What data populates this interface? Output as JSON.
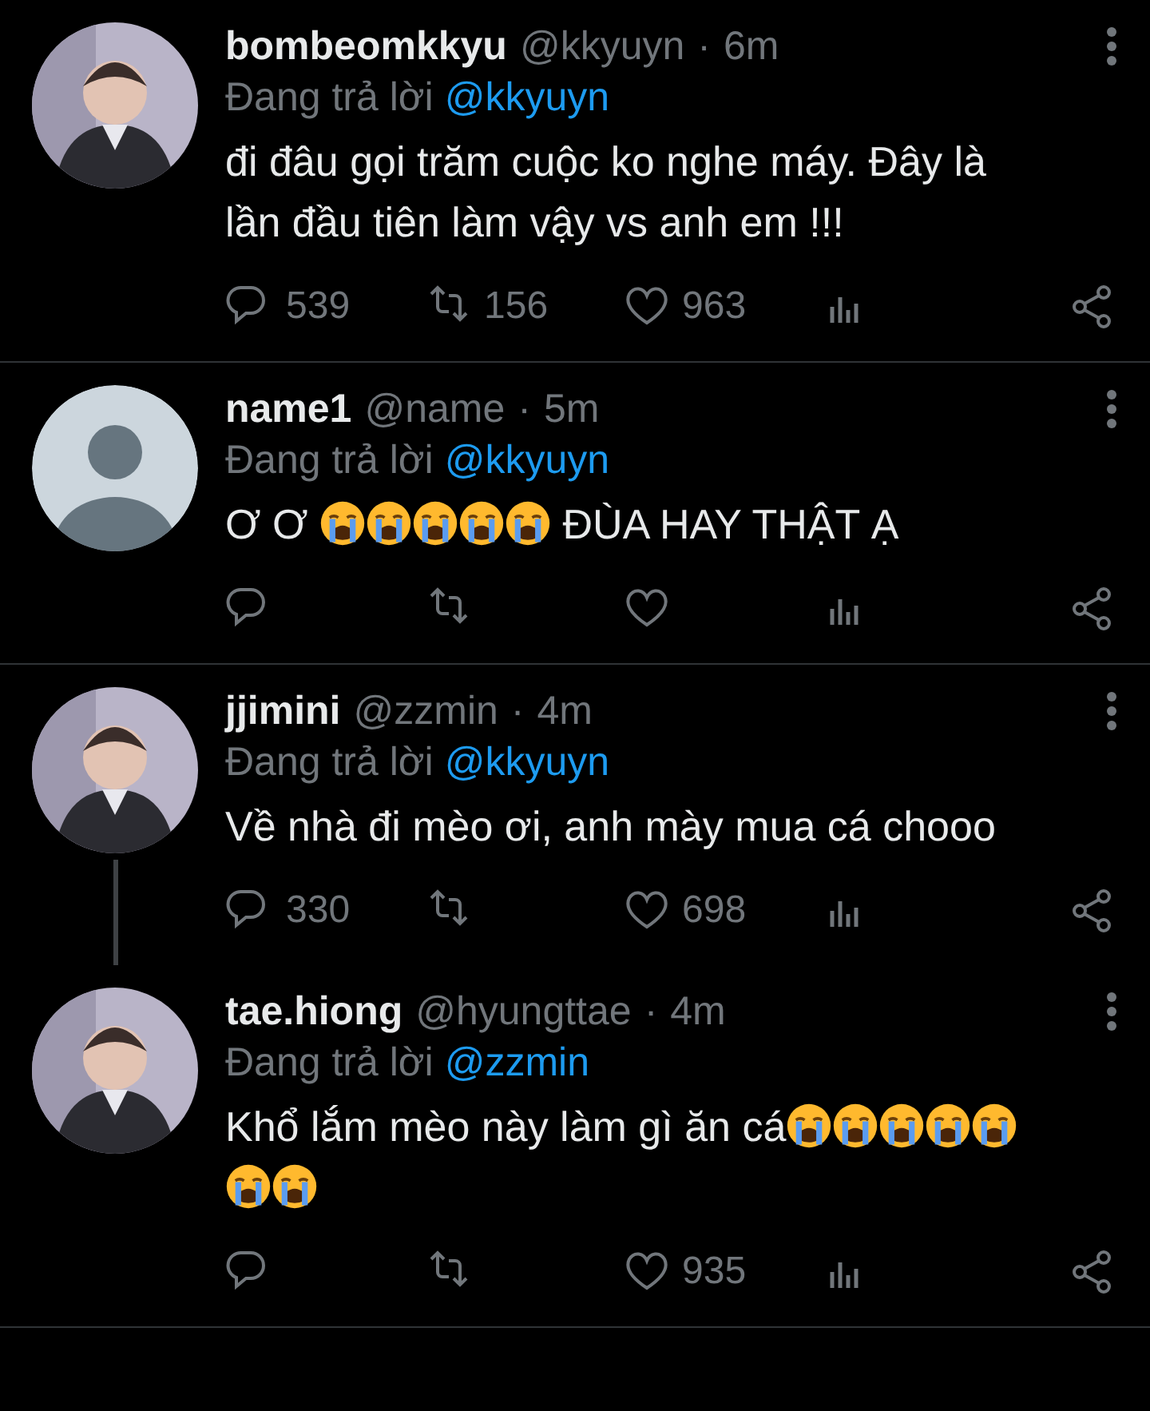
{
  "tweets": [
    {
      "name": "bombeomkkyu",
      "handle": "@kkyuyn",
      "separator": "·",
      "time": "6m",
      "reply_prefix": "Đang trả lời",
      "reply_to": "@kkyuyn",
      "body": [
        {
          "kind": "text",
          "text": "đi đâu gọi trăm cuộc ko nghe máy. Đây là lần đầu tiên làm vậy vs anh em !!!"
        }
      ],
      "replies": "539",
      "retweets": "156",
      "likes": "963",
      "connected_below": false
    },
    {
      "avatar": {
        "kind": "default"
      },
      "name": "name1",
      "handle": "@name",
      "separator": "·",
      "time": "5m",
      "reply_prefix": "Đang trả lời",
      "reply_to": "@kkyuyn",
      "body": [
        {
          "kind": "text",
          "text": "Ơ Ơ "
        },
        {
          "kind": "emoji"
        },
        {
          "kind": "emoji"
        },
        {
          "kind": "emoji"
        },
        {
          "kind": "emoji"
        },
        {
          "kind": "emoji"
        },
        {
          "kind": "text",
          "text": " ĐÙA HAY THẬT Ạ"
        }
      ],
      "connected_below": false
    },
    {
      "name": "jjimini",
      "handle": "@zzmin",
      "separator": "·",
      "time": "4m",
      "reply_prefix": "Đang trả lời",
      "reply_to": "@kkyuyn",
      "body": [
        {
          "kind": "text",
          "text": "Về nhà đi mèo ơi, anh mày mua cá chooo"
        }
      ],
      "replies": "330",
      "likes": "698",
      "connected_below": true
    },
    {
      "name": "tae.hiong",
      "handle": "@hyungttae",
      "separator": "·",
      "time": "4m",
      "reply_prefix": "Đang trả lời",
      "reply_to": "@zzmin",
      "body": [
        {
          "kind": "text",
          "text": "Khổ lắm mèo này làm gì ăn cá"
        },
        {
          "kind": "emoji"
        },
        {
          "kind": "emoji"
        },
        {
          "kind": "emoji"
        },
        {
          "kind": "emoji"
        },
        {
          "kind": "emoji"
        },
        {
          "kind": "emoji"
        },
        {
          "kind": "emoji"
        }
      ],
      "likes": "935",
      "connected_below": false
    }
  ]
}
